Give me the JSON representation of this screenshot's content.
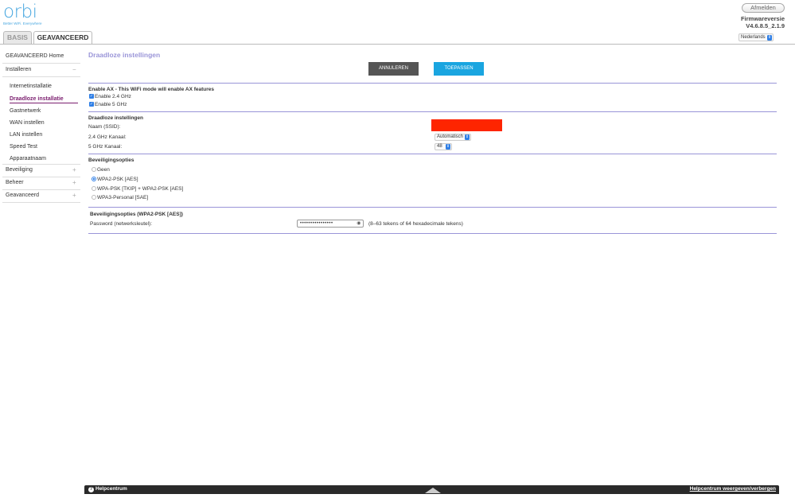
{
  "brand": {
    "name": "orbi",
    "tagline": "Better WiFi. Everywhere"
  },
  "header": {
    "logout_label": "Afmelden",
    "firmware_label": "Firmwareversie",
    "firmware_version": "V4.6.8.5_2.1.9",
    "language": "Nederlands"
  },
  "tabs": {
    "basic": "BASIS",
    "advanced": "GEAVANCEERD"
  },
  "sidebar": {
    "home": "GEAVANCEERD Home",
    "install": "Installeren",
    "install_sign": "−",
    "subitems": [
      "Internetinstallatie",
      "Draadloze installatie",
      "Gastnetwerk",
      "WAN instellen",
      "LAN instellen",
      "Speed Test",
      "Apparaatnaam"
    ],
    "security": "Beveiliging",
    "management": "Beheer",
    "advanced": "Geavanceerd",
    "plus": "+"
  },
  "main": {
    "title": "Draadloze instellingen",
    "cancel_label": "ANNULEREN",
    "apply_label": "TOEPASSEN",
    "ax": {
      "title": "Enable AX - This WiFi mode will enable AX features",
      "enable_24": "Enable 2.4 GHz",
      "enable_5": "Enable 5 GHz"
    },
    "wireless": {
      "title": "Draadloze instellingen",
      "ssid_label": "Naam (SSID):",
      "channel_24_label": "2.4 GHz Kanaal:",
      "channel_24_value": "Automatisch",
      "channel_5_label": "5 GHz Kanaal:",
      "channel_5_value": "48"
    },
    "security": {
      "title": "Beveiligingsopties",
      "options": [
        "Geen",
        "WPA2-PSK [AES]",
        "WPA-PSK [TKIP] + WPA2-PSK [AES]",
        "WPA3-Personal [SAE]"
      ],
      "selected": "WPA2-PSK [AES]"
    },
    "wpa2": {
      "title": "Beveiligingsopties (WPA2-PSK [AES])",
      "password_label": "Password (netwerksleutel):",
      "password_value": "••••••••••••••••",
      "password_hint": "(8–63 tekens of 64 hexadecimale tekens)"
    }
  },
  "footer": {
    "help_label": "Helpcentrum",
    "help_toggle": "Helpcentrum weergeven/verbergen"
  },
  "colors": {
    "accent": "#9a95d8",
    "active_nav": "#7b1e6f",
    "apply": "#1aa5e0",
    "cancel": "#555555",
    "ssid_field": "#fe2500"
  },
  "icons": {
    "spinner": "chevron-updown-icon",
    "eye": "eye-icon",
    "help": "question-icon",
    "arrow": "arrow-up-icon"
  }
}
